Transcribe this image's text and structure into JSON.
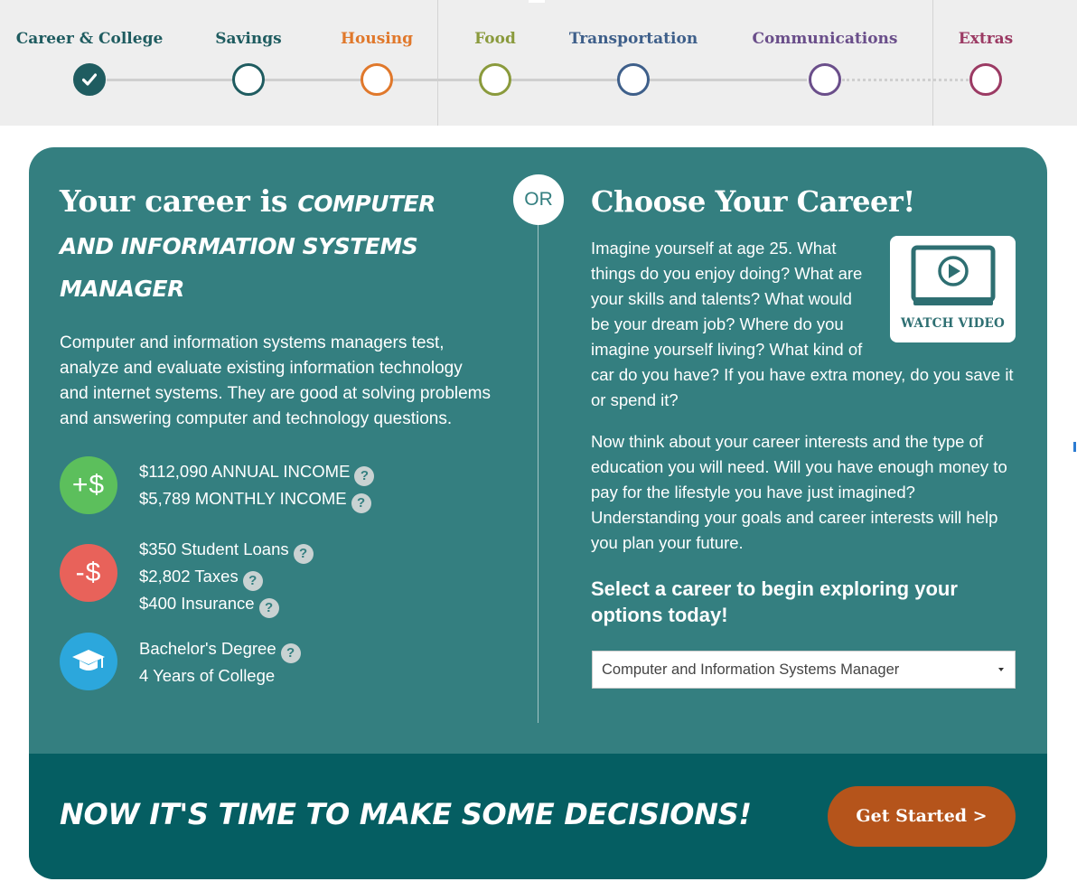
{
  "steps": [
    {
      "label": "Career & College",
      "color": "#1f5c60",
      "done": true
    },
    {
      "label": "Savings",
      "color": "#1f5c60",
      "done": false
    },
    {
      "label": "Housing",
      "color": "#e0782b",
      "done": false
    },
    {
      "label": "Food",
      "color": "#8a9a3c",
      "done": false
    },
    {
      "label": "Transportation",
      "color": "#3e5f8a",
      "done": false
    },
    {
      "label": "Communications",
      "color": "#6a4e8a",
      "done": false
    },
    {
      "label": "Extras",
      "color": "#9b3a63",
      "done": false
    }
  ],
  "left": {
    "title_prefix": "Your career is ",
    "career_name": "Computer and Information Systems Manager",
    "description": "Computer and information systems managers test, analyze and evaluate existing information technology and internet systems. They are good at solving problems and answering computer and technology questions.",
    "income": {
      "icon": "+$",
      "color": "#5cbf5c",
      "annual": "$112,090 ANNUAL INCOME",
      "monthly": "$5,789 MONTHLY INCOME"
    },
    "expenses": {
      "icon": "-$",
      "color": "#e8625a",
      "loans": "$350 Student Loans",
      "taxes": "$2,802 Taxes",
      "insurance": "$400 Insurance"
    },
    "education": {
      "icon": "graduation-cap-icon",
      "color": "#2ca7dc",
      "degree": "Bachelor's Degree",
      "years": "4 Years of College"
    },
    "help_glyph": "?"
  },
  "or_label": "OR",
  "right": {
    "title": "Choose Your Career!",
    "para1": "Imagine yourself at age 25. What things do you enjoy doing? What are your skills and talents? What would be your dream job? Where do you imagine yourself living? What kind of car do you have? If you have extra money, do you save it or spend it?",
    "para2": "Now think about your career interests and the type of education you will need. Will you have enough money to pay for the lifestyle you have just imagined? Understanding your goals and career interests will help you plan your future.",
    "select_prompt": "Select a career to begin exploring your options today!",
    "selected_career": "Computer and Information Systems Manager",
    "video_label": "WATCH VIDEO"
  },
  "cta": {
    "slogan": "Now it's time to make some decisions!",
    "button": "Get Started >"
  }
}
